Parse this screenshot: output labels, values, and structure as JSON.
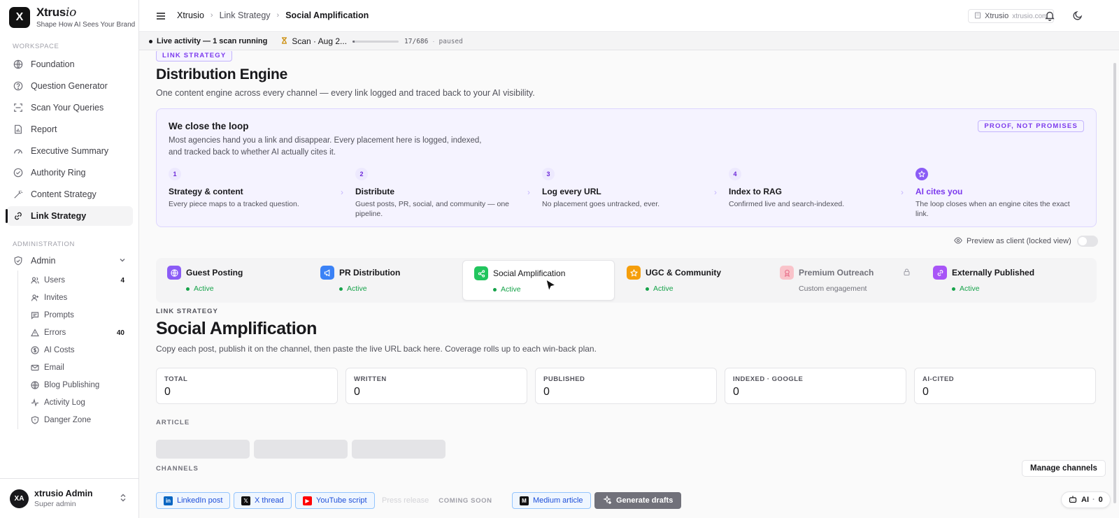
{
  "brand": {
    "logo_letter": "X",
    "name_main": "Xtrus",
    "name_italic": "io",
    "tagline": "Shape How AI Sees Your Brand"
  },
  "sidebar": {
    "workspace_label": "WORKSPACE",
    "items": [
      {
        "label": "Foundation",
        "icon": "globe-icon"
      },
      {
        "label": "Question Generator",
        "icon": "help-circle-icon"
      },
      {
        "label": "Scan Your Queries",
        "icon": "scan-icon"
      },
      {
        "label": "Report",
        "icon": "file-chart-icon"
      },
      {
        "label": "Executive Summary",
        "icon": "gauge-icon"
      },
      {
        "label": "Authority Ring",
        "icon": "check-circle-icon"
      },
      {
        "label": "Content Strategy",
        "icon": "wand-icon"
      },
      {
        "label": "Link Strategy",
        "icon": "link-icon",
        "active": true
      }
    ],
    "admin_label": "ADMINISTRATION",
    "admin": {
      "label": "Admin"
    },
    "admin_items": [
      {
        "label": "Users",
        "count": "4"
      },
      {
        "label": "Invites"
      },
      {
        "label": "Prompts"
      },
      {
        "label": "Errors",
        "count": "40"
      },
      {
        "label": "AI Costs"
      },
      {
        "label": "Email"
      },
      {
        "label": "Blog Publishing"
      },
      {
        "label": "Activity Log"
      },
      {
        "label": "Danger Zone"
      }
    ],
    "user": {
      "initials": "XA",
      "name": "xtrusio Admin",
      "role": "Super admin"
    }
  },
  "topbar": {
    "breadcrumbs": [
      "Xtrusio",
      "Link Strategy",
      "Social Amplification"
    ],
    "workspace": {
      "name": "Xtrusio",
      "domain": "xtrusio.com"
    }
  },
  "activity": {
    "text": "Live activity — 1 scan running",
    "scan_label": "Scan · Aug 2...",
    "progress_fraction": 0.025,
    "count": "17/686",
    "sep": "·",
    "state": "paused"
  },
  "page": {
    "eyebrow": "LINK STRATEGY",
    "title": "Distribution Engine",
    "subtitle": "One content engine across every channel — every link logged and traced back to your AI visibility."
  },
  "loop": {
    "title": "We close the loop",
    "desc": "Most agencies hand you a link and disappear. Every placement here is logged, indexed, and tracked back to whether AI actually cites it.",
    "badge": "PROOF, NOT PROMISES",
    "steps": [
      {
        "num": "1",
        "title": "Strategy & content",
        "desc": "Every piece maps to a tracked question."
      },
      {
        "num": "2",
        "title": "Distribute",
        "desc": "Guest posts, PR, social, and community — one pipeline."
      },
      {
        "num": "3",
        "title": "Log every URL",
        "desc": "No placement goes untracked, ever."
      },
      {
        "num": "4",
        "title": "Index to RAG",
        "desc": "Confirmed live and search-indexed."
      },
      {
        "num": "",
        "title": "AI cites you",
        "desc": "The loop closes when an engine cites the exact link."
      }
    ]
  },
  "preview_toggle": {
    "label": "Preview as client (locked view)"
  },
  "channel_tabs": [
    {
      "label": "Guest Posting",
      "status": "Active",
      "color": "#8b5cf6"
    },
    {
      "label": "PR Distribution",
      "status": "Active",
      "color": "#3b82f6"
    },
    {
      "label": "Social Amplification",
      "status": "Active",
      "color": "#22c55e",
      "active": true
    },
    {
      "label": "UGC & Community",
      "status": "Active",
      "color": "#f59e0b"
    },
    {
      "label": "Premium Outreach",
      "status": "Custom engagement",
      "color": "#fda4af",
      "locked": true
    },
    {
      "label": "Externally Published",
      "status": "Active",
      "color": "#a855f7"
    }
  ],
  "section": {
    "eyebrow": "LINK STRATEGY",
    "title": "Social Amplification",
    "subtitle": "Copy each post, publish it on the channel, then paste the live URL back here. Coverage rolls up to each win-back plan."
  },
  "stats": [
    {
      "label": "TOTAL",
      "value": "0"
    },
    {
      "label": "WRITTEN",
      "value": "0"
    },
    {
      "label": "PUBLISHED",
      "value": "0"
    },
    {
      "label": "INDEXED · GOOGLE",
      "value": "0"
    },
    {
      "label": "AI-CITED",
      "value": "0"
    }
  ],
  "article_label": "ARTICLE",
  "channels_label": "CHANNELS",
  "manage_label": "Manage channels",
  "channel_chips": [
    {
      "label": "LinkedIn post",
      "icon": "linkedin-icon",
      "glyph": "in",
      "color": "#0a66c2"
    },
    {
      "label": "X thread",
      "icon": "x-logo-icon",
      "glyph": "𝕏",
      "color": "#111111"
    },
    {
      "label": "YouTube script",
      "icon": "youtube-icon",
      "glyph": "▶",
      "color": "#ff0000"
    },
    {
      "label": "Press release",
      "soon": "COMING SOON",
      "disabled": true
    },
    {
      "label": "Medium article",
      "icon": "medium-icon",
      "glyph": "M",
      "color": "#111111"
    }
  ],
  "generate_label": "Generate drafts",
  "ai_chip": {
    "label": "AI",
    "sep": "·",
    "count": "0"
  }
}
